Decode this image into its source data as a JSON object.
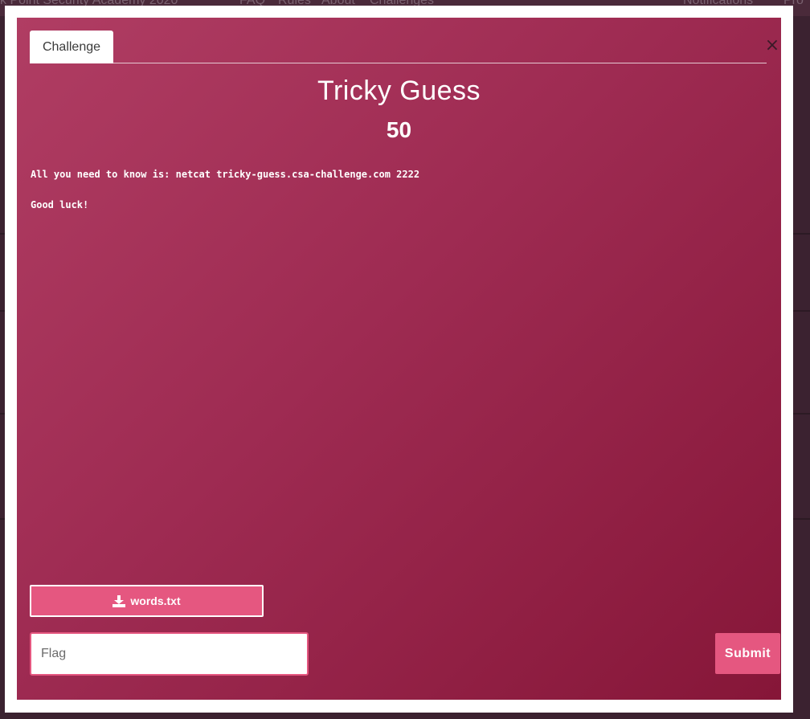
{
  "background": {
    "site_title": "k Point Security Academy 2020",
    "nav": [
      "FAQ",
      "Rules",
      "About",
      "Challenges"
    ],
    "notifications": "Notifications",
    "profile": "Pro"
  },
  "modal": {
    "tab_label": "Challenge",
    "close_symbol": "×",
    "title": "Tricky Guess",
    "points": "50",
    "description": [
      "All you need to know is: netcat tricky-guess.csa-challenge.com 2222",
      "Good luck!"
    ],
    "file": {
      "name": "words.txt",
      "icon": "download-icon"
    },
    "flag_placeholder": "Flag",
    "submit_label": "Submit"
  },
  "colors": {
    "accent": "#e55780",
    "gradient_start": "#b03d63",
    "gradient_end": "#861638"
  }
}
